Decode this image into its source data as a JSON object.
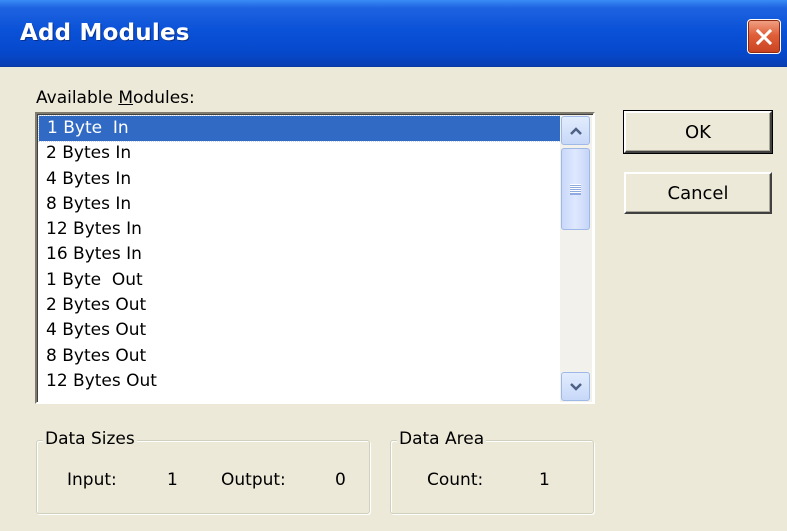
{
  "window": {
    "title": "Add Modules",
    "close_label": "×"
  },
  "available": {
    "label_pre": "Available ",
    "label_ul": "M",
    "label_post": "odules:",
    "items": [
      "1 Byte  In",
      "2 Bytes In",
      "4 Bytes In",
      "8 Bytes In",
      "12 Bytes In",
      "16 Bytes In",
      "1 Byte  Out",
      "2 Bytes Out",
      "4 Bytes Out",
      "8 Bytes Out",
      "12 Bytes Out"
    ],
    "selected_index": 0
  },
  "buttons": {
    "ok": "OK",
    "cancel": "Cancel"
  },
  "data_sizes": {
    "title": "Data Sizes",
    "input_label": "Input:",
    "input_value": "1",
    "output_label": "Output:",
    "output_value": "0"
  },
  "data_area": {
    "title": "Data Area",
    "count_label": "Count:",
    "count_value": "1"
  },
  "colors": {
    "title_bar": "#0a52d8",
    "selection": "#316ac5",
    "face": "#ece9d8"
  }
}
